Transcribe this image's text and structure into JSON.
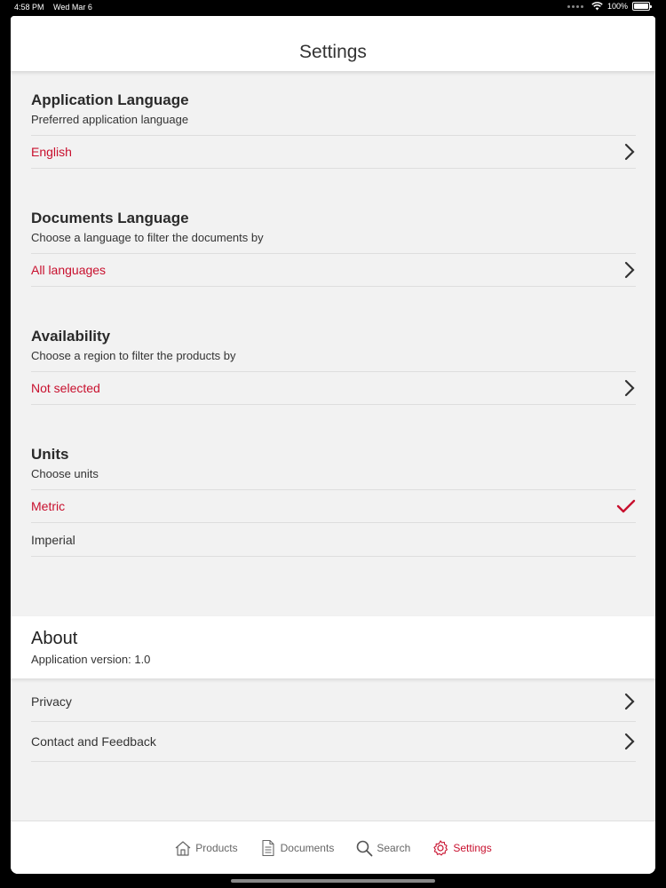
{
  "status_bar": {
    "time": "4:58 PM",
    "date": "Wed Mar 6",
    "battery": "100%"
  },
  "nav": {
    "title": "Settings"
  },
  "sections": [
    {
      "title": "Application Language",
      "subtitle": "Preferred application language",
      "value": "English"
    },
    {
      "title": "Documents Language",
      "subtitle": "Choose a language to filter the documents by",
      "value": "All languages"
    },
    {
      "title": "Availability",
      "subtitle": "Choose a region to filter the products by",
      "value": "Not selected"
    }
  ],
  "units": {
    "title": "Units",
    "subtitle": "Choose units",
    "options": [
      {
        "label": "Metric",
        "selected": true
      },
      {
        "label": "Imperial",
        "selected": false
      }
    ]
  },
  "about": {
    "title": "About",
    "version": "Application version: 1.0",
    "items": [
      {
        "label": "Privacy"
      },
      {
        "label": "Contact and Feedback"
      }
    ]
  },
  "tab_bar": {
    "tabs": [
      {
        "label": "Products",
        "icon": "home-icon"
      },
      {
        "label": "Documents",
        "icon": "document-icon"
      },
      {
        "label": "Search",
        "icon": "search-icon"
      },
      {
        "label": "Settings",
        "icon": "gear-icon",
        "active": true
      }
    ]
  },
  "colors": {
    "accent": "#c8102e",
    "background": "#f2f2f2",
    "text": "#333333"
  }
}
